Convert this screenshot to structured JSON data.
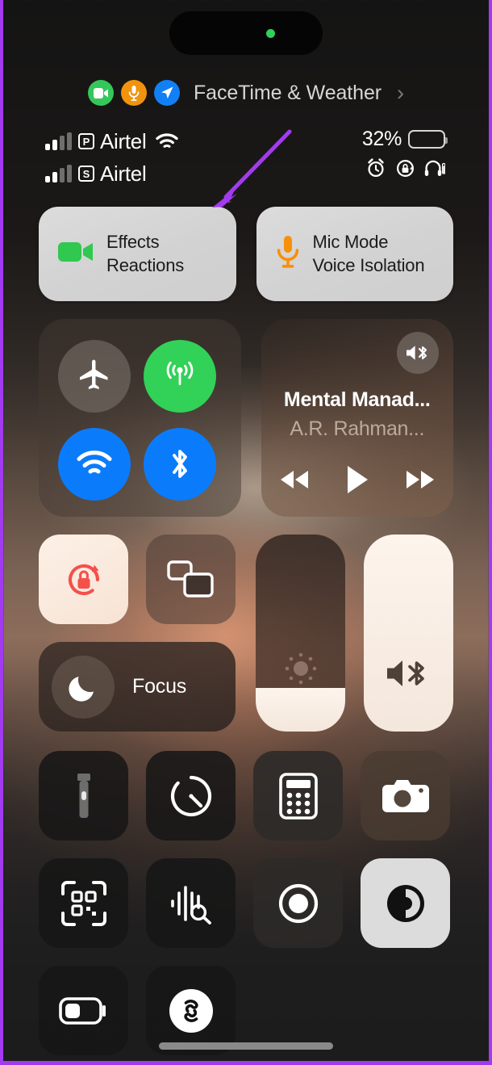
{
  "device": {
    "platform": "iOS Control Center",
    "accent_purple": "#a23bef"
  },
  "dynamic_island": {
    "indicator_name": "green-recording-dot",
    "indicator_color": "#30d158"
  },
  "privacy_banner": {
    "title": "FaceTime & Weather",
    "chevron": "›",
    "indicators": [
      {
        "name": "camera-in-use",
        "color": "#35c759"
      },
      {
        "name": "microphone-in-use",
        "color": "#f0930d"
      },
      {
        "name": "location-in-use",
        "color": "#1180f5"
      }
    ]
  },
  "status_bar": {
    "sims": [
      {
        "tag": "P",
        "carrier": "Airtel",
        "signal_bars": 2,
        "has_wifi": true
      },
      {
        "tag": "S",
        "carrier": "Airtel",
        "signal_bars": 2,
        "has_wifi": false
      }
    ],
    "battery_percent": "32%",
    "battery_level": 32,
    "right_icons": [
      "alarm-clock-icon",
      "rotation-lock-icon",
      "headphones-battery-icon"
    ]
  },
  "banners": [
    {
      "name": "effects",
      "icon": "video-camera-icon",
      "icon_color": "#30c84f",
      "title": "Effects",
      "subtitle": "Reactions"
    },
    {
      "name": "mic-mode",
      "icon": "microphone-icon",
      "icon_color": "#f79009",
      "title": "Mic Mode",
      "subtitle": "Voice Isolation"
    }
  ],
  "connectivity": {
    "toggles": [
      {
        "name": "airplane-mode",
        "icon": "airplane-icon",
        "state": "off",
        "color": "#807670"
      },
      {
        "name": "cellular-data",
        "icon": "cellular-antenna-icon",
        "state": "on",
        "color": "#32d158"
      },
      {
        "name": "wifi",
        "icon": "wifi-icon",
        "state": "on",
        "color": "#0a7cfb"
      },
      {
        "name": "bluetooth",
        "icon": "bluetooth-icon",
        "state": "on",
        "color": "#0a7cfb"
      }
    ]
  },
  "now_playing": {
    "track_title": "Mental Manad...",
    "artist": "A.R. Rahman...",
    "route_icon": "airplay-bluetooth-audio-icon",
    "controls": [
      "rewind-button",
      "play-button",
      "fast-forward-button"
    ],
    "playback_state": "paused"
  },
  "middle_tiles": [
    {
      "name": "rotation-lock",
      "icon": "rotation-lock-icon",
      "state": "on",
      "icon_color": "#f5504b"
    },
    {
      "name": "screen-mirroring",
      "icon": "screen-mirroring-icon",
      "state": "off",
      "icon_color": "#ffffff"
    }
  ],
  "focus": {
    "name": "focus",
    "icon": "crescent-moon-icon",
    "label": "Focus"
  },
  "sliders": [
    {
      "name": "brightness-slider",
      "icon": "brightness-sun-icon",
      "value_percent": 22
    },
    {
      "name": "volume-slider",
      "icon": "speaker-bluetooth-icon",
      "value_percent": 100
    }
  ],
  "utilities": [
    {
      "name": "flashlight",
      "icon": "flashlight-icon",
      "state": "off",
      "style": "dark"
    },
    {
      "name": "timer",
      "icon": "timer-icon",
      "state": "off",
      "style": "dark"
    },
    {
      "name": "calculator",
      "icon": "calculator-icon",
      "state": "off",
      "style": "grey"
    },
    {
      "name": "camera",
      "icon": "camera-icon",
      "state": "off",
      "style": "warm2"
    },
    {
      "name": "code-scanner",
      "icon": "qr-code-scanner-icon",
      "state": "off",
      "style": "dark"
    },
    {
      "name": "sound-recognition",
      "icon": "sound-recognition-icon",
      "state": "off",
      "style": "dark"
    },
    {
      "name": "screen-recording",
      "icon": "screen-record-icon",
      "state": "off",
      "style": "grey"
    },
    {
      "name": "dark-mode",
      "icon": "contrast-circle-icon",
      "state": "on",
      "style": "light"
    },
    {
      "name": "low-power-mode",
      "icon": "battery-icon",
      "state": "off",
      "style": "dark"
    },
    {
      "name": "shazam",
      "icon": "shazam-icon",
      "state": "off",
      "style": "dark"
    }
  ],
  "annotation": {
    "name": "callout-arrow",
    "color": "#a23bef",
    "points_to": "effects-banner"
  },
  "home_indicator": {
    "name": "home-indicator"
  }
}
